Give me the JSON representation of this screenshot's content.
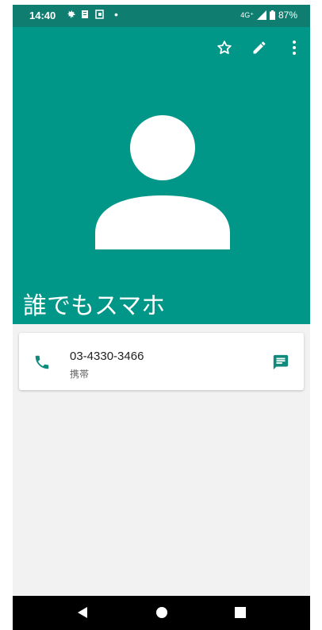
{
  "status": {
    "time": "14:40",
    "network": "4G⁺",
    "battery": "87%"
  },
  "contact": {
    "name": "誰でもスマホ"
  },
  "phone_entry": {
    "number": "03-4330-3466",
    "type": "携帯"
  },
  "icons": {
    "favorite": "star-outline-icon",
    "edit": "pencil-icon",
    "more": "more-vert-icon",
    "phone": "phone-icon",
    "message": "message-icon"
  },
  "colors": {
    "header": "#009688",
    "statusbar": "#0f7d70",
    "accent": "#009688"
  }
}
